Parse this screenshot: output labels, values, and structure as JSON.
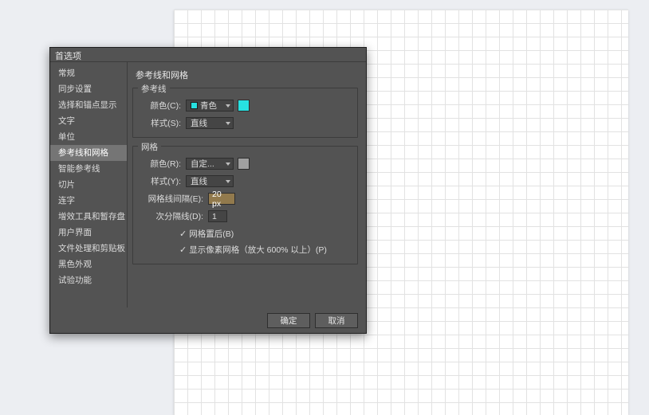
{
  "dialog": {
    "title": "首选项",
    "main_title": "参考线和网格",
    "ok_label": "确定",
    "cancel_label": "取消"
  },
  "sidebar": {
    "items": [
      "常规",
      "同步设置",
      "选择和锚点显示",
      "文字",
      "单位",
      "参考线和网格",
      "智能参考线",
      "切片",
      "连字",
      "增效工具和暂存盘",
      "用户界面",
      "文件处理和剪贴板",
      "黑色外观",
      "试验功能"
    ],
    "selected_index": 5
  },
  "guides": {
    "legend": "参考线",
    "color_label": "颜色(C):",
    "color_value": "青色",
    "color_swatch": "#27e1e1",
    "style_label": "样式(S):",
    "style_value": "直线"
  },
  "grid": {
    "legend": "网格",
    "color_label": "颜色(R):",
    "color_value": "自定...",
    "color_swatch": "#a0a0a0",
    "style_label": "样式(Y):",
    "style_value": "直线",
    "gridline_label": "网格线间隔(E):",
    "gridline_value": "20 px",
    "subdiv_label": "次分隔线(D):",
    "subdiv_value": "1",
    "check1_label": "网格置后(B)",
    "check2_label": "显示像素网格（放大 600% 以上）(P)"
  }
}
